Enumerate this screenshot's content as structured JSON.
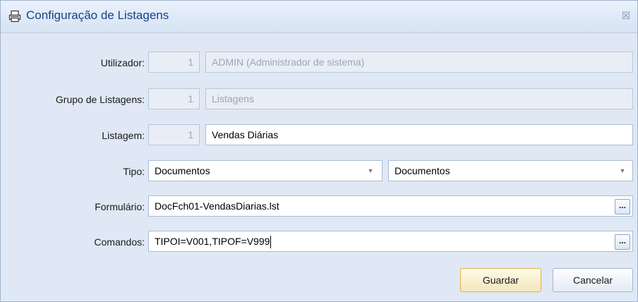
{
  "window": {
    "title": "Configuração de Listagens",
    "close_symbol": "☒"
  },
  "form": {
    "utilizador": {
      "label": "Utilizador:",
      "code": "1",
      "value": "ADMIN (Administrador de sistema)"
    },
    "grupo": {
      "label": "Grupo de Listagens:",
      "code": "1",
      "value": "Listagens"
    },
    "listagem": {
      "label": "Listagem:",
      "code": "1",
      "value": "Vendas Diárias"
    },
    "tipo": {
      "label": "Tipo:",
      "select1": "Documentos",
      "select2": "Documentos",
      "arrow": "▼"
    },
    "formulario": {
      "label": "Formulário:",
      "value": "DocFch01-VendasDiarias.lst",
      "button": "..."
    },
    "comandos": {
      "label": "Comandos:",
      "value": "TIPOI=V001,TIPOF=V999",
      "button": "..."
    }
  },
  "buttons": {
    "save": "Guardar",
    "cancel": "Cancelar"
  },
  "icons": {
    "title": "printer-icon"
  }
}
